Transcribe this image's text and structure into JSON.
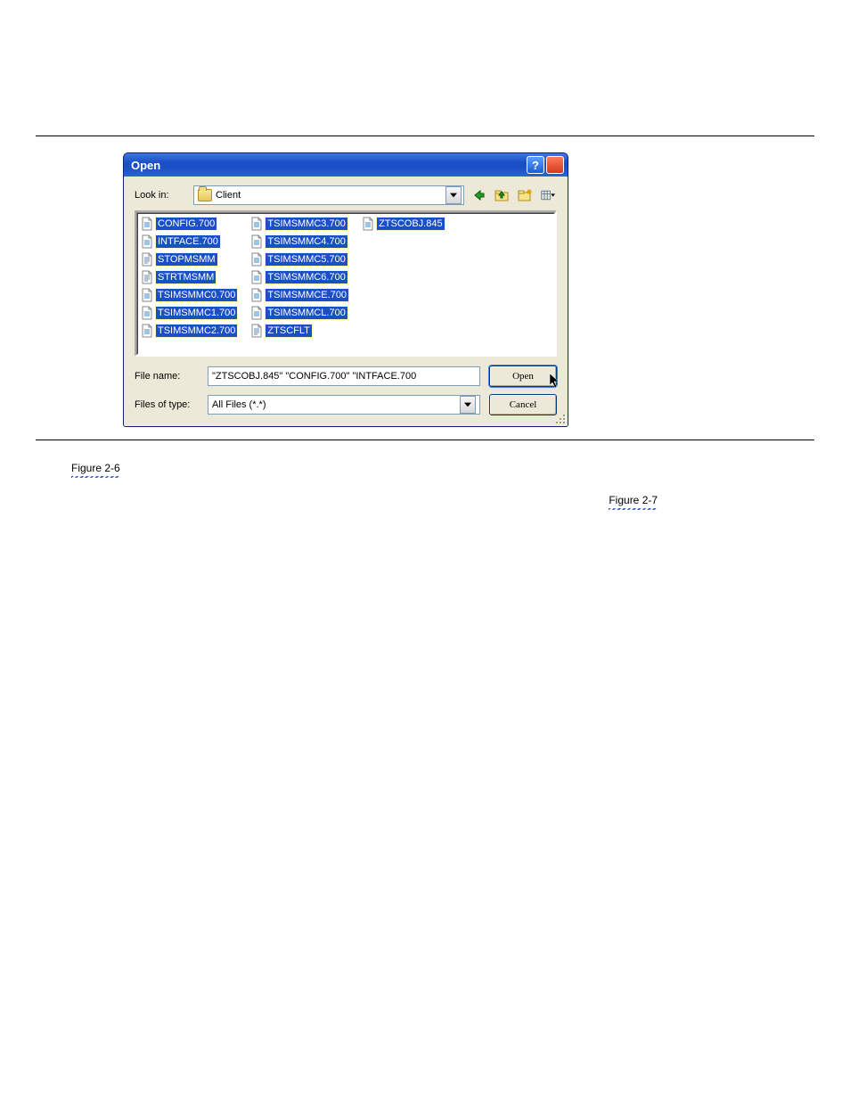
{
  "dialog": {
    "title": "Open",
    "lookin_label": "Look in:",
    "lookin_value": "Client",
    "filename_label": "File name:",
    "filename_value": "\"ZTSCOBJ.845\" \"CONFIG.700\" \"INTFACE.700",
    "filetype_label": "Files of type:",
    "filetype_value": "All Files (*.*)",
    "open_btn": "Open",
    "cancel_btn": "Cancel"
  },
  "files": [
    {
      "name": "CONFIG.700",
      "icon": "gen",
      "selected": true
    },
    {
      "name": "INTFACE.700",
      "icon": "gen",
      "selected": true
    },
    {
      "name": "STOPMSMM",
      "icon": "text",
      "selected": true
    },
    {
      "name": "STRTMSMM",
      "icon": "text",
      "selected": true
    },
    {
      "name": "TSIMSMMC0.700",
      "icon": "gen",
      "selected": true
    },
    {
      "name": "TSIMSMMC1.700",
      "icon": "gen",
      "selected": true
    },
    {
      "name": "TSIMSMMC2.700",
      "icon": "gen",
      "selected": true
    },
    {
      "name": "TSIMSMMC3.700",
      "icon": "gen",
      "selected": true
    },
    {
      "name": "TSIMSMMC4.700",
      "icon": "gen",
      "selected": true
    },
    {
      "name": "TSIMSMMC5.700",
      "icon": "gen",
      "selected": true
    },
    {
      "name": "TSIMSMMC6.700",
      "icon": "gen",
      "selected": true
    },
    {
      "name": "TSIMSMMCE.700",
      "icon": "gen",
      "selected": true
    },
    {
      "name": "TSIMSMMCL.700",
      "icon": "gen",
      "selected": true
    },
    {
      "name": "ZTSCFLT",
      "icon": "text",
      "selected": true
    },
    {
      "name": "ZTSCOBJ.845",
      "icon": "gen",
      "selected": true
    }
  ],
  "caption": {
    "fig_ref_1": "Figure 2-6",
    "fig_ref_2": "Figure 2-7"
  }
}
